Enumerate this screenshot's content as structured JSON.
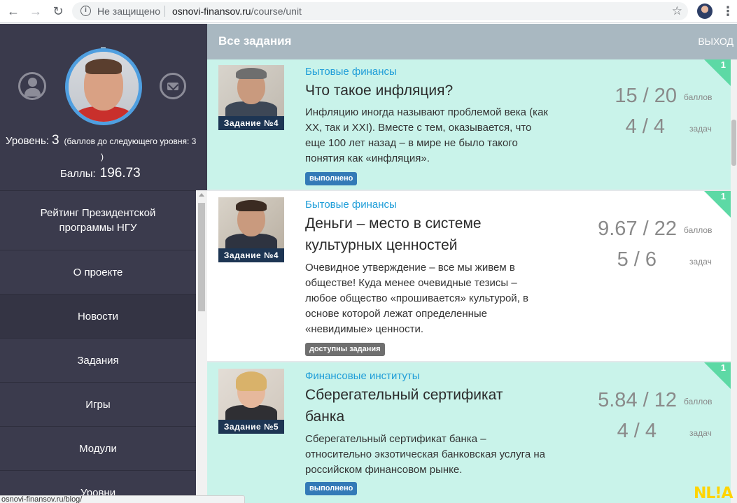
{
  "browser": {
    "security_label": "Не защищено",
    "url_host": "osnovi-finansov.ru",
    "url_path": "/course/unit",
    "status_url": "osnovi-finansov.ru/blog/"
  },
  "sidebar": {
    "level_label": "Уровень:",
    "level_value": "3",
    "level_hint": "(баллов до следующего уровня: 3",
    "level_hint_close": ")",
    "points_label": "Баллы:",
    "points_value": "196.73",
    "menu": [
      {
        "label": "Рейтинг Президентской программы НГУ"
      },
      {
        "label": "О проекте"
      },
      {
        "label": "Новости"
      },
      {
        "label": "Задания"
      },
      {
        "label": "Игры"
      },
      {
        "label": "Модули"
      },
      {
        "label": "Уровни"
      }
    ]
  },
  "header": {
    "title": "Все задания",
    "exit_label": "ВЫХОД"
  },
  "cards": [
    {
      "category": "Бытовые финансы",
      "title": "Что такое инфляция?",
      "description": "Инфляцию иногда называют проблемой века (как XX, так и XXI). Вместе с тем, оказывается, что еще 100 лет назад – в мире не было такого понятия как «инфляция».",
      "thumb_label": "Задание №4",
      "status": "выполнено",
      "score": "15 / 20",
      "score_unit": "баллов",
      "tasks": "4 / 4",
      "tasks_unit": "задач",
      "corner": "1"
    },
    {
      "category": "Бытовые финансы",
      "title": "Деньги – место в системе культурных ценностей",
      "description": "Очевидное утверждение – все мы живем в обществе! Куда менее очевидные тезисы – любое общество «прошивается» культурой, в основе которой лежат определенные «невидимые» ценности.",
      "thumb_label": "Задание №4",
      "status": "доступны задания",
      "score": "9.67 / 22",
      "score_unit": "баллов",
      "tasks": "5 / 6",
      "tasks_unit": "задач",
      "corner": "1"
    },
    {
      "category": "Финансовые институты",
      "title": "Сберегательный сертификат банка",
      "description": "Сберегательный сертификат банка – относительно экзотическая банковская услуга на российском финансовом рынке.",
      "thumb_label": "Задание №5",
      "status": "выполнено",
      "score": "5.84 / 12",
      "score_unit": "баллов",
      "tasks": "4 / 4",
      "tasks_unit": "задач",
      "corner": "1"
    }
  ],
  "watermark": "NL!A",
  "colors": {
    "sidebar_bg": "#3d3d4f",
    "header_bg": "#a9b8c1",
    "card_teal": "#c9f3ea",
    "category_blue": "#1e9dd8",
    "badge_done": "#337ab7",
    "badge_available": "#6f6f6f",
    "corner_green": "#5dd9a5",
    "avatar_ring": "#4f9fe0"
  },
  "icons": [
    "back-arrow-icon",
    "forward-arrow-icon",
    "reload-icon",
    "info-icon",
    "star-icon",
    "user-icon",
    "mail-icon",
    "kebab-menu-icon"
  ]
}
